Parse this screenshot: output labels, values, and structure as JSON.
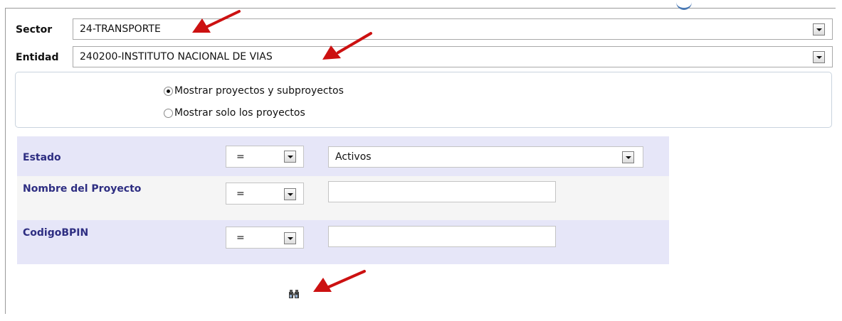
{
  "sector": {
    "label": "Sector",
    "value": "24-TRANSPORTE"
  },
  "entidad": {
    "label": "Entidad",
    "value": "240200-INSTITUTO NACIONAL DE VIAS"
  },
  "options": {
    "radio_projects_and_subprojects": "Mostrar proyectos y subproyectos",
    "radio_projects_only": "Mostrar solo los proyectos",
    "selected": "radio_projects_and_subprojects"
  },
  "filters": [
    {
      "label": "Estado",
      "operator": "=",
      "value": "Activos"
    },
    {
      "label": "Nombre del Proyecto",
      "operator": "=",
      "value": ""
    },
    {
      "label": "CodigoBPIN",
      "operator": "=",
      "value": ""
    }
  ],
  "colors": {
    "filter_row_band": "#e6e6f8",
    "filter_row_plain": "#f5f5f5",
    "filter_label": "#2e2e82",
    "annotation_arrow": "#cc1111"
  },
  "icons": {
    "search": "binoculars-icon",
    "annotation": "red-arrow-icon"
  }
}
